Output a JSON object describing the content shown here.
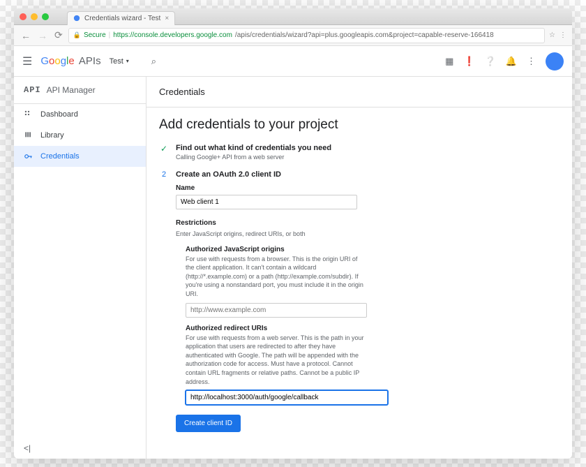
{
  "browser": {
    "tab_title": "Credentials wizard - Test",
    "secure": "Secure",
    "url_host": "https://console.developers.google.com",
    "url_path": "/apis/credentials/wizard?api=plus.googleapis.com&project=capable-reserve-166418"
  },
  "topbar": {
    "logo_apis": "APIs",
    "project": "Test"
  },
  "sidebar": {
    "api_badge": "API",
    "title": "API Manager",
    "items": [
      {
        "label": "Dashboard"
      },
      {
        "label": "Library"
      },
      {
        "label": "Credentials"
      }
    ]
  },
  "main": {
    "header": "Credentials",
    "title": "Add credentials to your project",
    "step1": {
      "title": "Find out what kind of credentials you need",
      "sub": "Calling Google+ API from a web server"
    },
    "step2": {
      "num": "2",
      "title": "Create an OAuth 2.0 client ID",
      "name_label": "Name",
      "name_value": "Web client 1",
      "restrictions_label": "Restrictions",
      "restrictions_desc": "Enter JavaScript origins, redirect URIs, or both",
      "js": {
        "label": "Authorized JavaScript origins",
        "desc": "For use with requests from a browser. This is the origin URI of the client application. It can't contain a wildcard (http://*.example.com) or a path (http://example.com/subdir). If you're using a nonstandard port, you must include it in the origin URI.",
        "placeholder": "http://www.example.com"
      },
      "redirect": {
        "label": "Authorized redirect URIs",
        "desc": "For use with requests from a web server. This is the path in your application that users are redirected to after they have authenticated with Google. The path will be appended with the authorization code for access. Must have a protocol. Cannot contain URL fragments or relative paths. Cannot be a public IP address.",
        "value": "http://localhost:3000/auth/google/callback"
      },
      "button": "Create client ID"
    }
  }
}
